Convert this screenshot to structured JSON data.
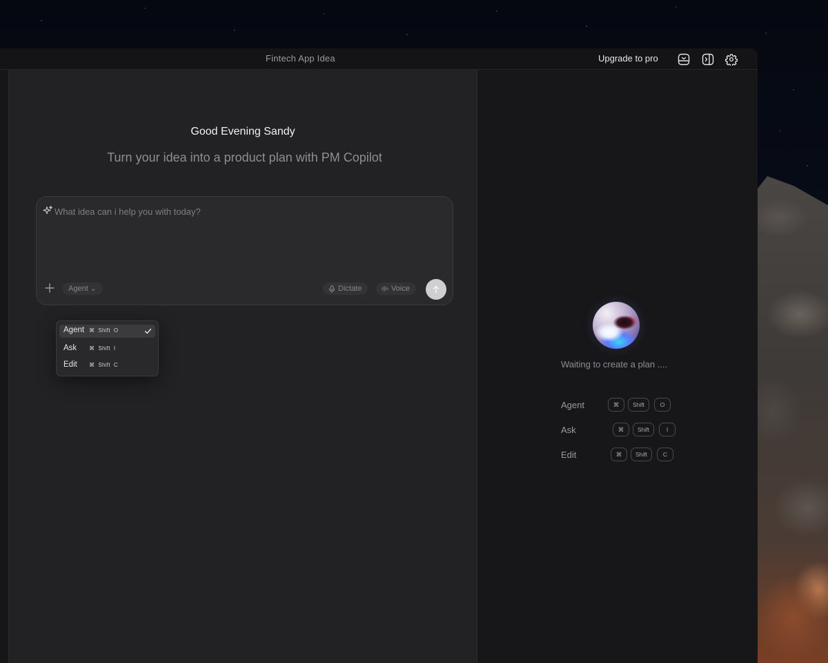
{
  "window": {
    "title": "Fintech App Idea",
    "upgrade_label": "Upgrade to pro",
    "toolbar_icons": [
      "bot-icon",
      "panel-toggle-icon",
      "gear-icon"
    ]
  },
  "main": {
    "greeting": "Good Evening Sandy",
    "subtitle": "Turn your idea into a product plan with PM Copilot",
    "composer": {
      "placeholder": "What idea can i help you with today?",
      "agent_chip": "Agent ⌄",
      "dictate_label": "Dictate",
      "voice_label": "Voice"
    },
    "mode_menu": [
      {
        "label": "Agent",
        "shortcut": "⌘  Shift  O",
        "selected": true
      },
      {
        "label": "Ask",
        "shortcut": "⌘  Shift  I",
        "selected": false
      },
      {
        "label": "Edit",
        "shortcut": "⌘  Shift  C",
        "selected": false
      }
    ]
  },
  "right_panel": {
    "waiting_text": "Waiting to create a plan ....",
    "shortcuts": [
      {
        "label": "Agent",
        "keys": [
          "⌘",
          "Shift",
          "O"
        ]
      },
      {
        "label": "Ask",
        "keys": [
          "⌘",
          "Shift",
          "I"
        ]
      },
      {
        "label": "Edit",
        "keys": [
          "⌘",
          "Shift",
          "C"
        ]
      }
    ]
  },
  "colors": {
    "window_bg": "#1c1c1e",
    "main_bg": "#222224",
    "panel_bg": "#171719",
    "send_button": "#cfcfd2"
  }
}
